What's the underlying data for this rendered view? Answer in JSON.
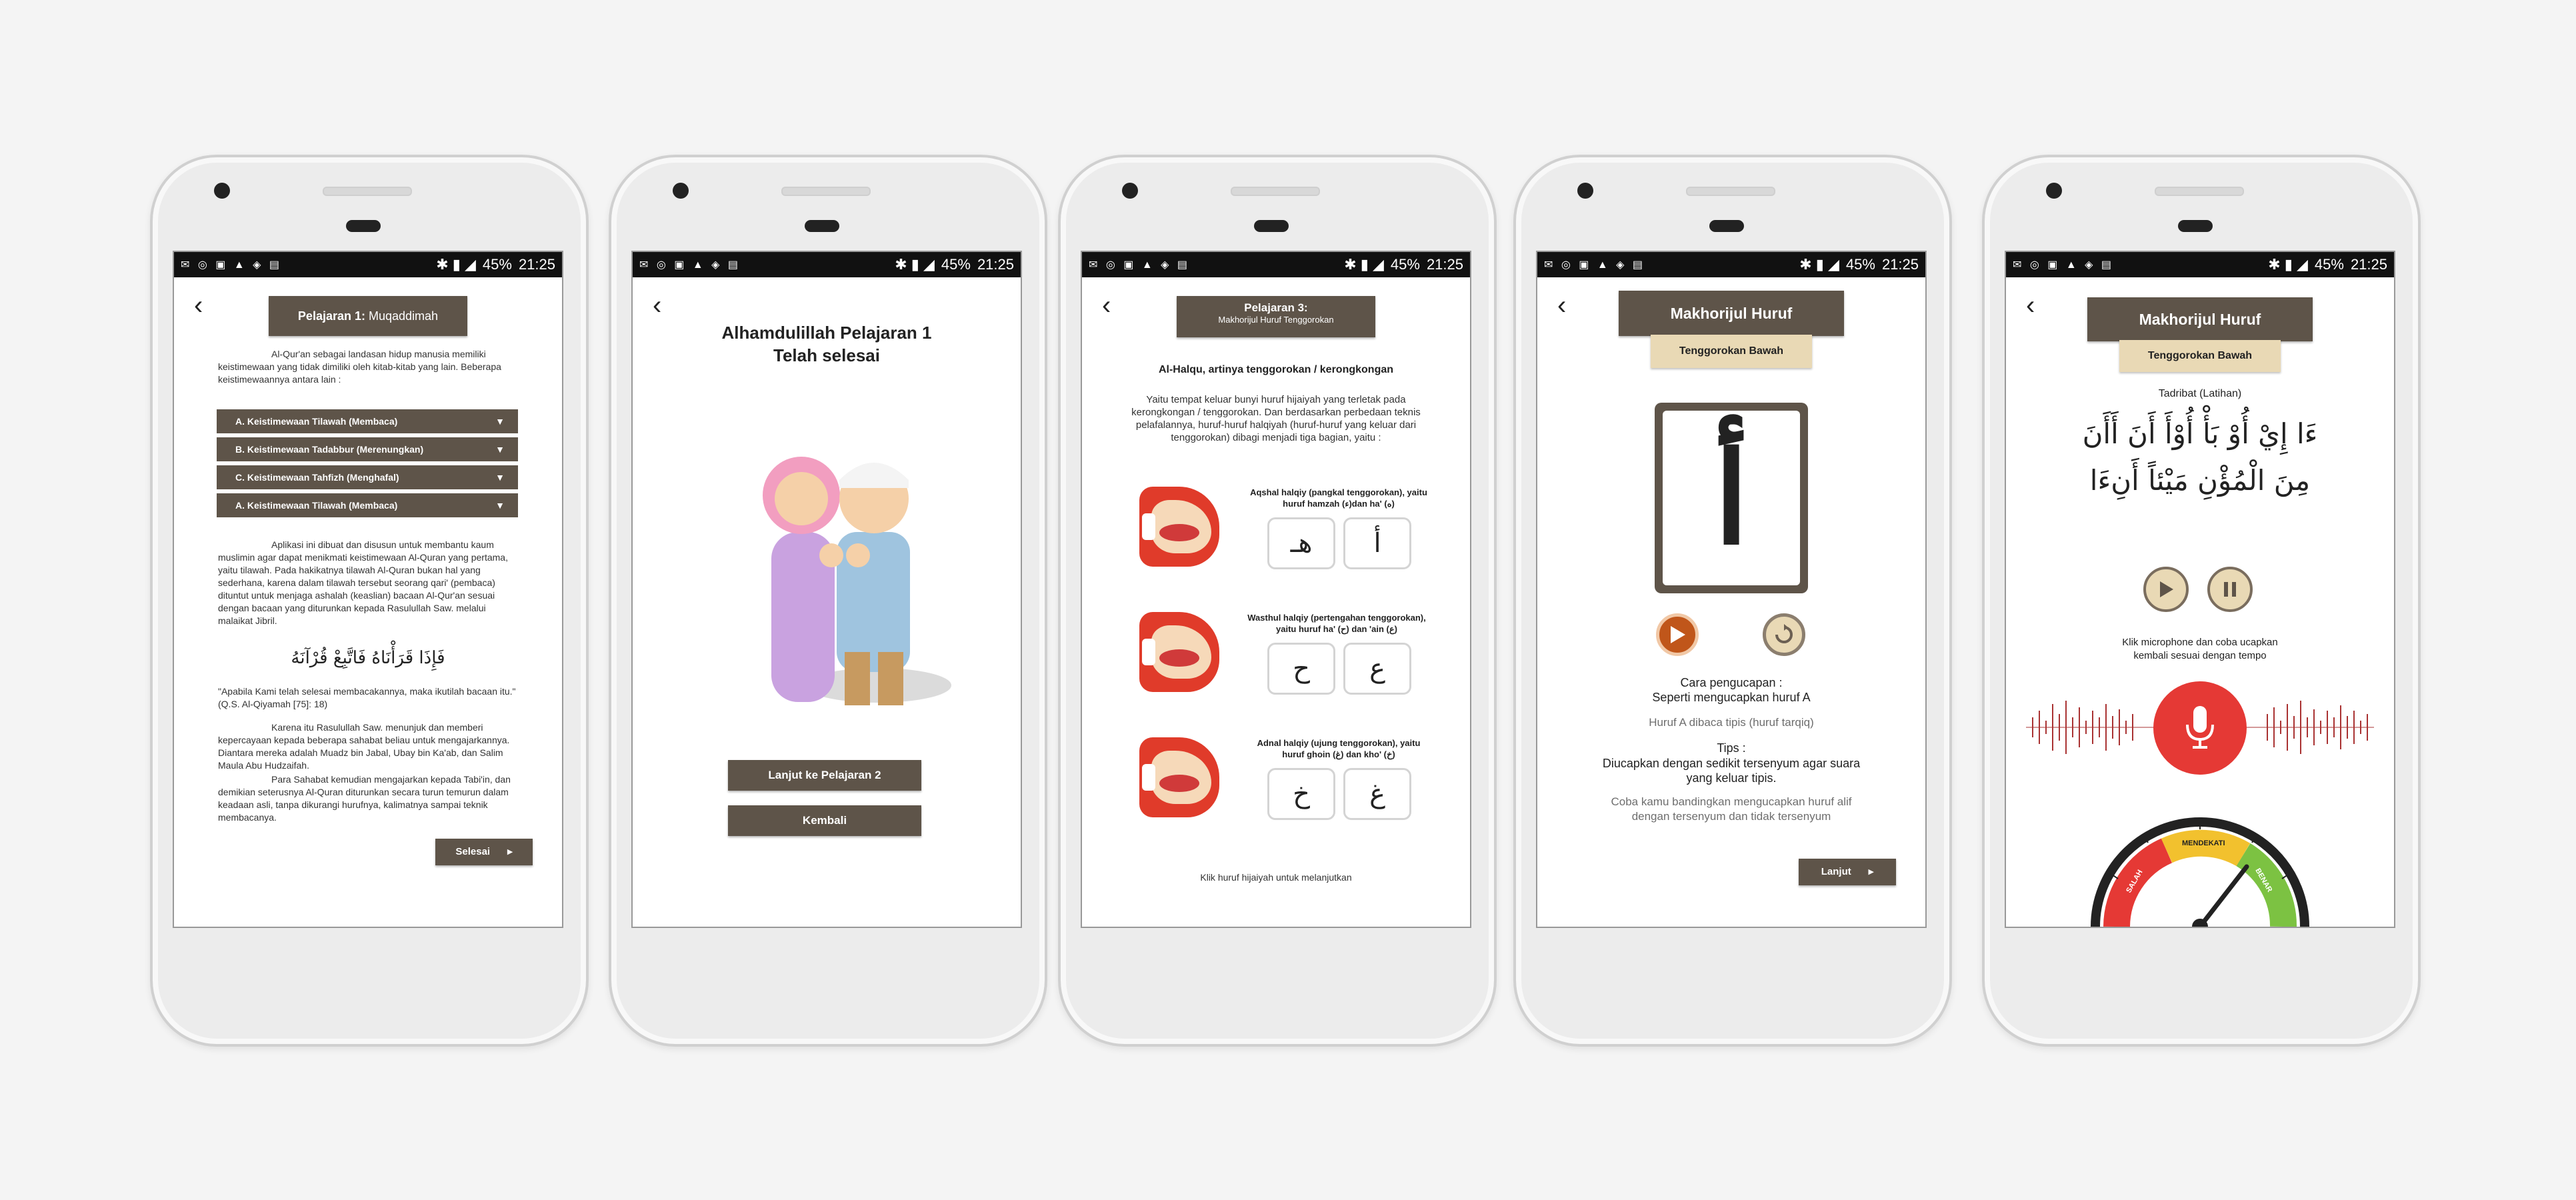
{
  "status_bar": {
    "battery": "45%",
    "time": "21:25"
  },
  "screen1": {
    "title_prefix": "Pelajaran 1:",
    "title_suffix": " Muqaddimah",
    "intro": "Al-Qur'an sebagai landasan hidup manusia memiliki keistimewaan yang tidak dimiliki oleh kitab-kitab yang lain. Beberapa keistimewaannya antara lain :",
    "accordion": [
      "A. Keistimewaan Tilawah (Membaca)",
      "B. Keistimewaan Tadabbur (Merenungkan)",
      "C. Keistimewaan Tahfizh (Menghafal)",
      "A. Keistimewaan Tilawah (Membaca)"
    ],
    "para2": "Aplikasi ini dibuat dan disusun untuk membantu kaum muslimin agar dapat menikmati keistimewaan Al-Quran yang pertama, yaitu tilawah. Pada hakikatnya tilawah Al-Quran bukan hal yang sederhana, karena dalam tilawah tersebut seorang qari' (pembaca) dituntut untuk menjaga ashalah (keaslian) bacaan Al-Qur'an sesuai dengan bacaan yang diturunkan kepada Rasulullah Saw. melalui malaikat Jibril.",
    "ayah": "فَإِذَا قَرَأْنَاهُ فَاتَّبِعْ قُرْآنَهُ",
    "translation": "\"Apabila Kami telah selesai membacakannya, maka ikutilah bacaan itu.\" (Q.S. Al-Qiyamah [75]: 18)",
    "para3": "Karena itu Rasulullah Saw. menunjuk dan memberi kepercayaan kepada beberapa sahabat beliau untuk mengajarkannya. Diantara mereka adalah Muadz bin Jabal, Ubay bin Ka'ab, dan Salim Maula Abu Hudzaifah.",
    "para4": "Para Sahabat kemudian mengajarkan kepada Tabi'in, dan demikian seterusnya Al-Quran diturunkan secara turun temurun dalam keadaan asli, tanpa dikurangi hurufnya, kalimatnya sampai teknik membacanya.",
    "finish_button": "Selesai"
  },
  "screen2": {
    "title_line1": "Alhamdulillah Pelajaran 1",
    "title_line2": "Telah selesai",
    "next_button": "Lanjut ke Pelajaran 2",
    "back_button": "Kembali"
  },
  "screen3": {
    "title": "Pelajaran 3:",
    "subtitle": "Makhorijul Huruf Tenggorokan",
    "heading": "Al-Halqu, artinya tenggorokan / kerongkongan",
    "intro": "Yaitu tempat keluar bunyi huruf hijaiyah yang terletak pada kerongkongan / tenggorokan. Dan berdasarkan perbedaan teknis pelafalannya, huruf-huruf halqiyah (huruf-huruf yang keluar dari tenggorokan) dibagi menjadi tiga bagian, yaitu :",
    "sections": [
      {
        "label": "Aqshal halqiy (pangkal tenggorokan), yaitu huruf hamzah (ء)dan ha' (ه)",
        "letters": [
          "هـ",
          "أ"
        ]
      },
      {
        "label": "Wasthul halqiy (pertengahan tenggorokan), yaitu huruf ha' (ح) dan 'ain (ع)",
        "letters": [
          "ح",
          "ع"
        ]
      },
      {
        "label": "Adnal halqiy (ujung tenggorokan), yaitu huruf ghoin (غ) dan kho' (خ)",
        "letters": [
          "خ",
          "غ"
        ]
      }
    ],
    "footer": "Klik huruf hijaiyah untuk melanjutkan"
  },
  "screen4": {
    "title": "Makhorijul Huruf",
    "subtitle": "Tenggorokan Bawah",
    "letter": "أ",
    "pronounce_label": "Cara pengucapan :",
    "pronounce_text": "Seperti mengucapkan huruf A",
    "note": "Huruf A dibaca tipis (huruf tarqiq)",
    "tips_label": "Tips :",
    "tips_text": "Diucapkan dengan sedikit tersenyum agar suara yang keluar tipis.",
    "compare": "Coba kamu bandingkan mengucapkan huruf alif dengan tersenyum dan tidak tersenyum",
    "next_button": "Lanjut"
  },
  "screen5": {
    "title": "Makhorijul Huruf",
    "subtitle": "Tenggorokan Bawah",
    "exercise": "Tadribat (Latihan)",
    "arabic_line1": "ءَا إِيْ أُوْ بَأْ أُوْأَ أَنَ أَأَنَ",
    "arabic_line2": "مِنَ الْمُؤْنِ مَيْئاً أَنِءَا",
    "instruction": "Klik microphone dan coba ucapkan kembali sesuai dengan tempo",
    "gauge_labels": [
      "SALAH",
      "MENDEKATI",
      "BENAR"
    ],
    "colors": {
      "accent": "#5e5449",
      "gold": "#e9d9b5",
      "red": "#e53935",
      "orange": "#c0561a"
    }
  }
}
